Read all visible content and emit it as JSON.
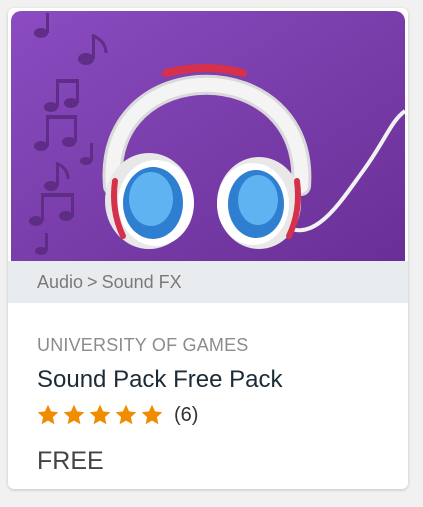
{
  "product": {
    "category": {
      "parent": "Audio",
      "separator": ">",
      "child": "Sound FX"
    },
    "publisher": "UNIVERSITY OF GAMES",
    "title": "Sound Pack Free Pack",
    "rating": {
      "stars": 5,
      "max_stars": 5,
      "count": "(6)"
    },
    "price": "FREE"
  },
  "thumbnail": {
    "icon": "headphones-icon",
    "decoration": "music-notes"
  },
  "colors": {
    "thumbnail_background": "#7a3fa8",
    "category_bar": "#e9ecee",
    "star": "#f08c00",
    "title": "#1c2b36"
  }
}
